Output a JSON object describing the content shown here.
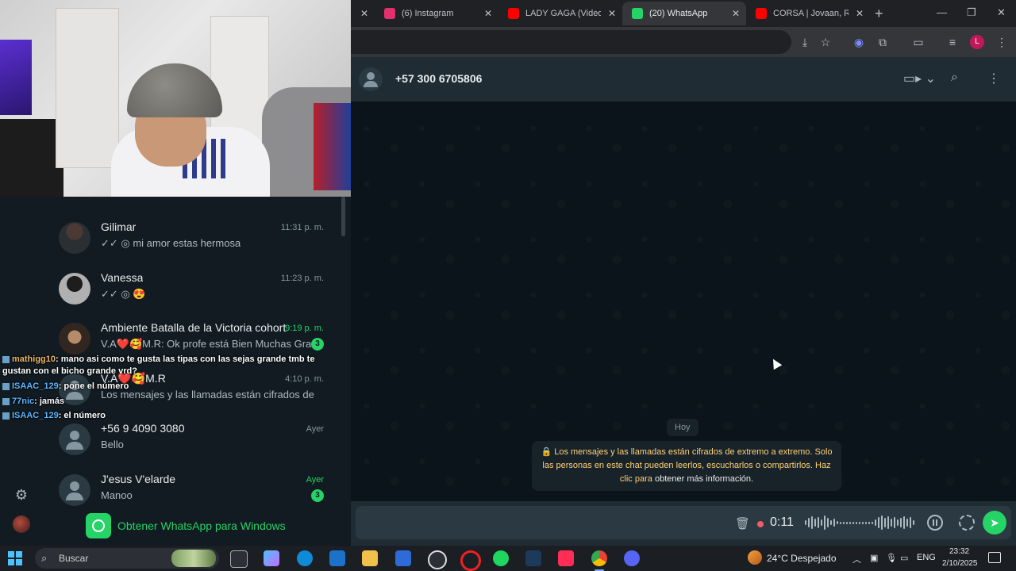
{
  "browser": {
    "tabs": [
      {
        "label": "",
        "favicon_color": "#202124"
      },
      {
        "label": "(6) Instagram",
        "favicon_color": "#e1306c"
      },
      {
        "label": "LADY GAGA (Video O",
        "favicon_color": "#ff0000"
      },
      {
        "label": "(20) WhatsApp",
        "favicon_color": "#25d366"
      },
      {
        "label": "CORSA | Jovaan, Rem",
        "favicon_color": "#ff0000"
      }
    ],
    "active_tab": 3,
    "profile_letter": "L"
  },
  "chat_list": [
    {
      "name": "Gilimar",
      "time": "11:31 p. m.",
      "preview": "✓✓ ◎ mi amor estas hermosa",
      "unread": "",
      "avatar": "person"
    },
    {
      "name": "Vanessa",
      "time": "11:23 p. m.",
      "preview": "✓✓ ◎ 😍",
      "unread": "",
      "avatar": "bw"
    },
    {
      "name": "Ambiente Batalla de la Victoria cohort...",
      "time": "9:19 p. m.",
      "preview": "V.A❤️🥰M.R: Ok profe está Bien Muchas Graci...",
      "unread": "3",
      "avatar": "portrait"
    },
    {
      "name": "V.A❤️🥰M.R",
      "time": "4:10 p. m.",
      "preview": "Los mensajes y las llamadas están cifrados de extre...",
      "unread": "",
      "avatar": "default"
    },
    {
      "name": "+56 9 4090 3080",
      "time": "Ayer",
      "preview": "Bello",
      "unread": "",
      "avatar": "default"
    },
    {
      "name": "J'esus V'elarde",
      "time": "Ayer",
      "preview": "Manoo",
      "unread": "3",
      "avatar": "default"
    }
  ],
  "get_windows_label": "Obtener WhatsApp para Windows",
  "stream_chat": [
    {
      "user": "mathigg10",
      "text": ": mano asi como te gusta las tipas con las sejas grande tmb te",
      "user_class": "gold"
    },
    {
      "user": "",
      "text": "gustan con el bicho grande vrd?",
      "user_class": ""
    },
    {
      "user": "ISAAC_129",
      "text": ": pone el número",
      "user_class": ""
    },
    {
      "user": "77nic",
      "text": ": jamás",
      "user_class": ""
    },
    {
      "user": "ISAAC_129",
      "text": ": el número",
      "user_class": ""
    }
  ],
  "conversation": {
    "contact_name": "+57 300 6705806",
    "date_label": "Hoy",
    "encryption_notice": "🔒 Los mensajes y las llamadas están cifrados de extremo a extremo. Solo las personas en este chat pueden leerlos, escucharlos o compartirlos. Haz clic para",
    "encryption_more": "obtener más información.",
    "recording_time": "0:11"
  },
  "taskbar": {
    "search_placeholder": "Buscar",
    "weather": "24°C  Despejado",
    "language": "ENG",
    "time": "23:32",
    "date": "2/10/2025"
  }
}
